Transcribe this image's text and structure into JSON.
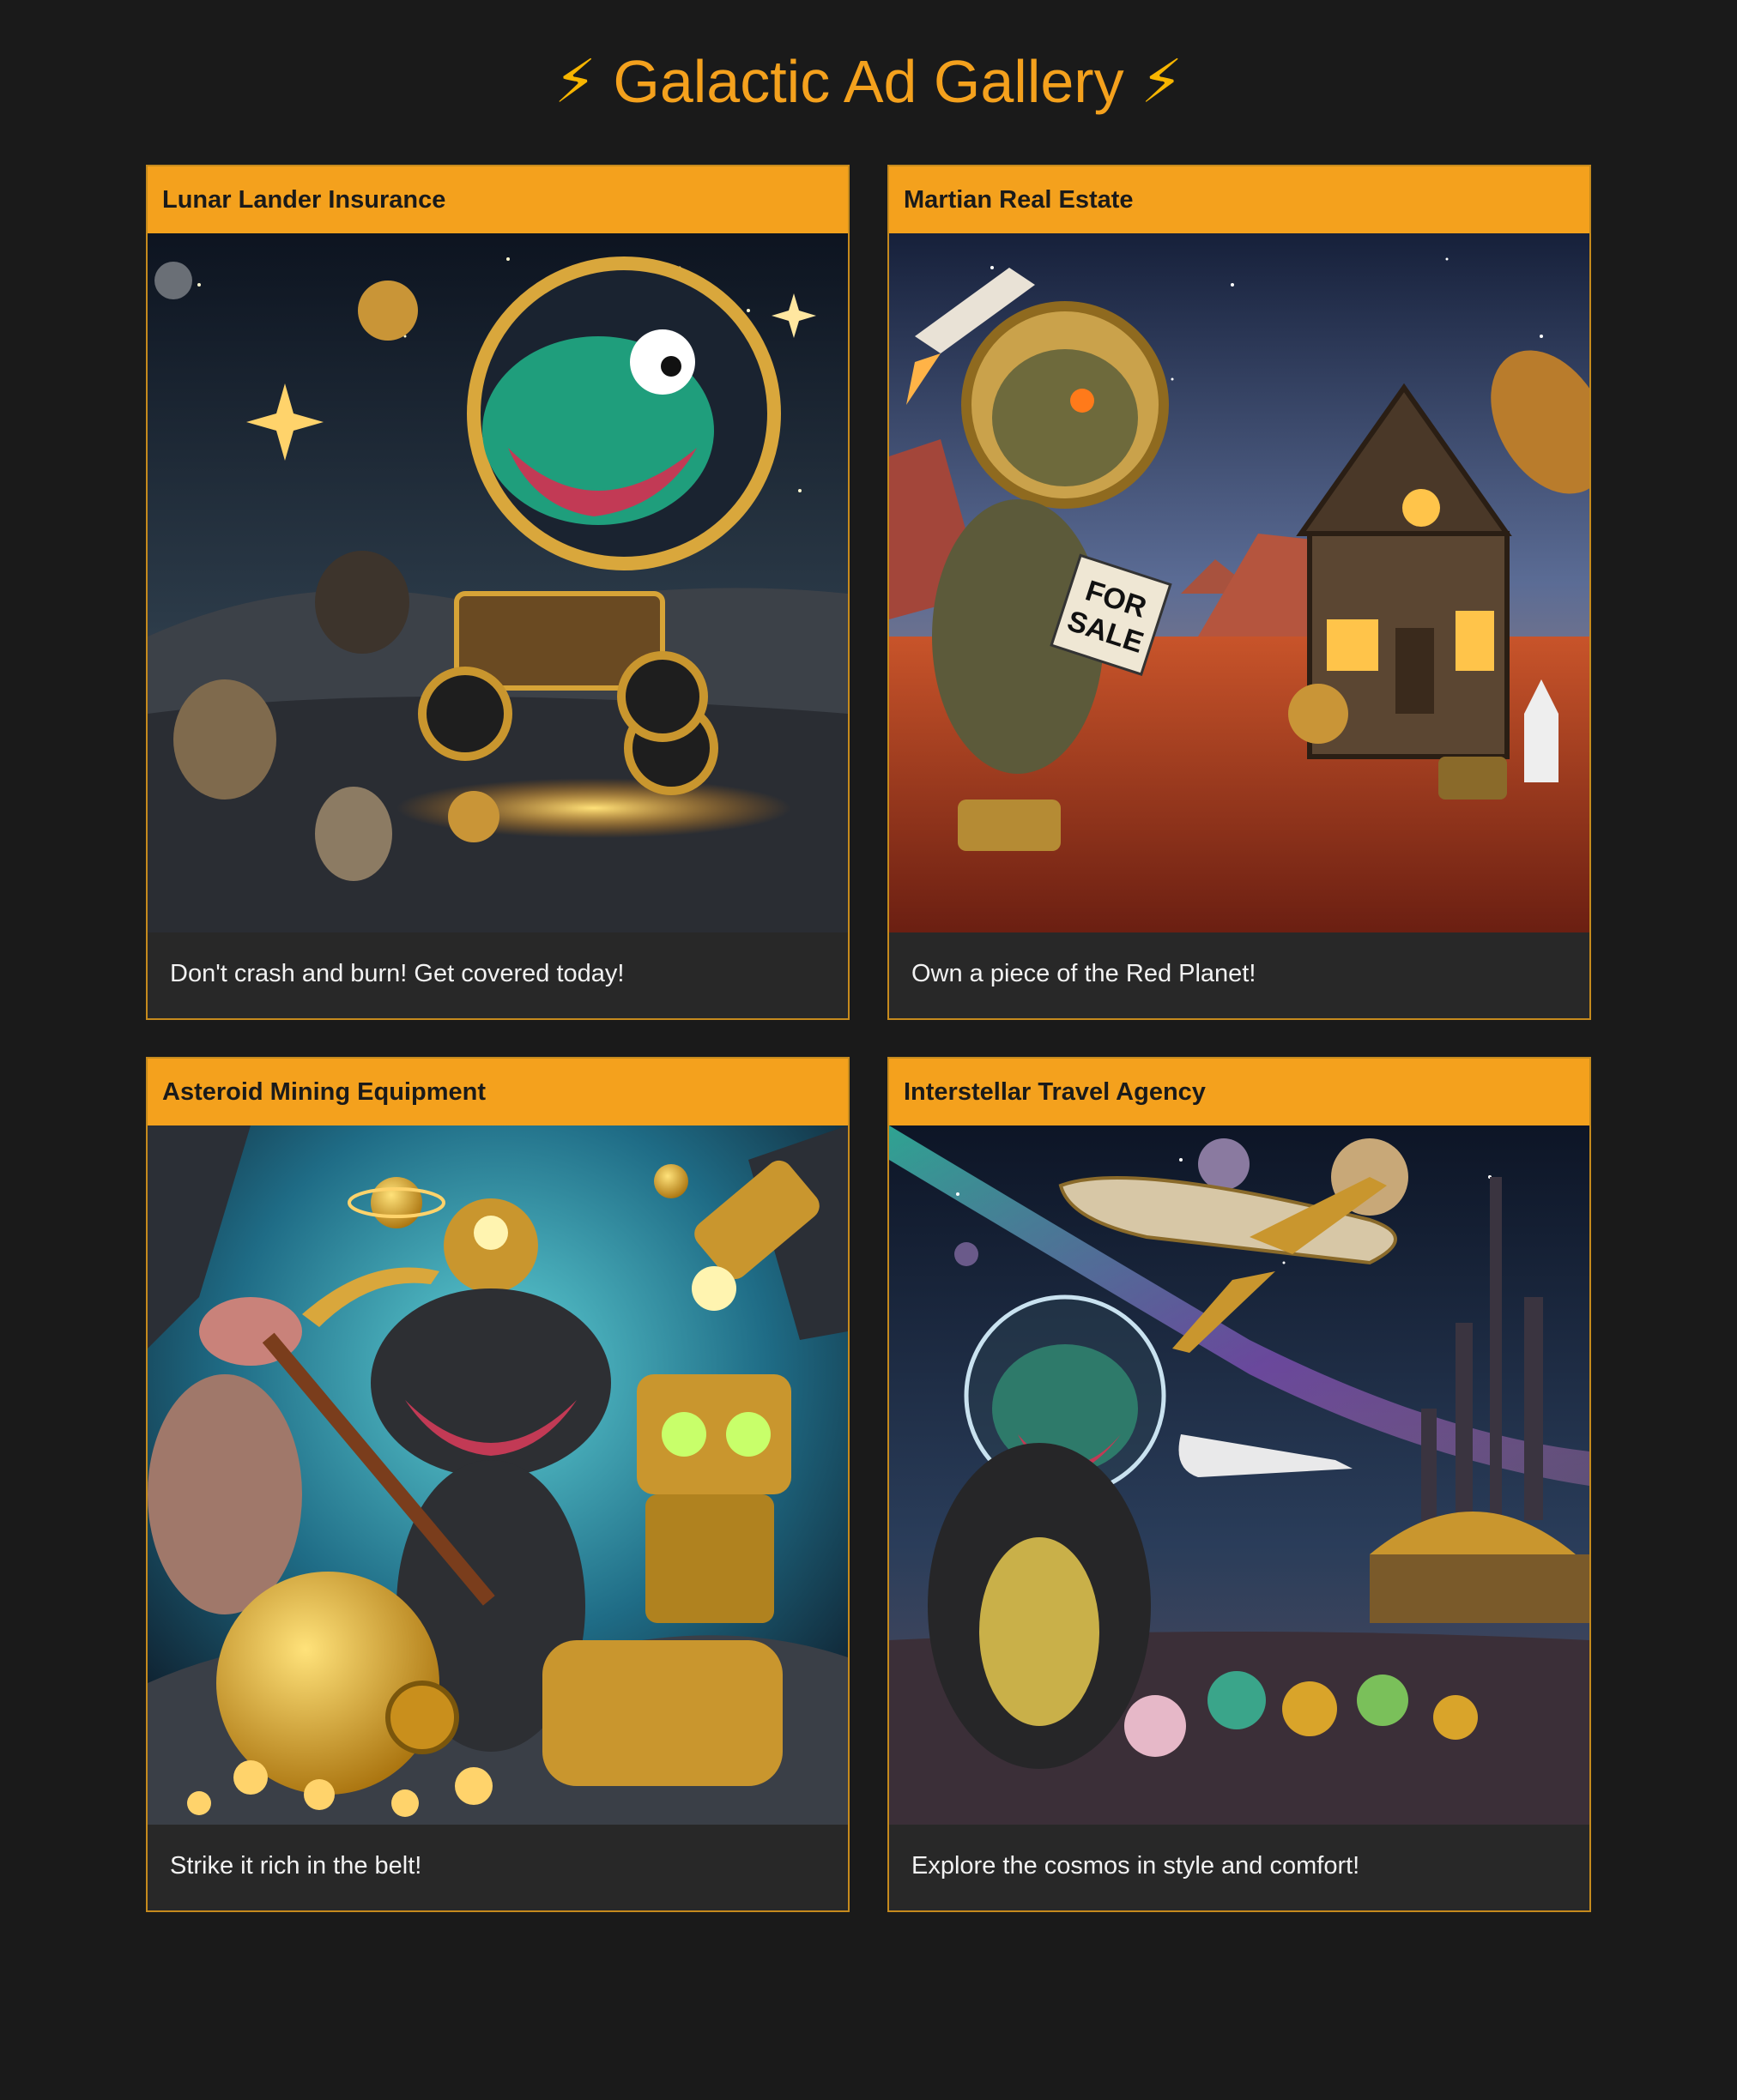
{
  "page": {
    "title": "Galactic Ad Gallery",
    "title_icon": "lightning-bolt-icon",
    "title_icon_glyph": "⚡",
    "accent_color": "#f4a11d",
    "background_color": "#1a1a1a"
  },
  "ads": [
    {
      "id": "lunar-lander-insurance",
      "title": "Lunar Lander Insurance",
      "caption": "Don't crash and burn! Get covered today!",
      "image_subject": "dinosaur-astronaut-moon-buggy-illustration"
    },
    {
      "id": "martian-real-estate",
      "title": "Martian Real Estate",
      "caption": "Own a piece of the Red Planet!",
      "image_subject": "dinosaur-mars-house-for-sale-illustration",
      "sign_text": [
        "FOR",
        "SALE"
      ]
    },
    {
      "id": "asteroid-mining-equipment",
      "title": "Asteroid Mining Equipment",
      "caption": "Strike it rich in the belt!",
      "image_subject": "dinosaur-miner-robot-gold-illustration"
    },
    {
      "id": "interstellar-travel-agency",
      "title": "Interstellar Travel Agency",
      "caption": "Explore the cosmos in style and comfort!",
      "image_subject": "dinosaur-tourists-spaceport-illustration"
    }
  ]
}
